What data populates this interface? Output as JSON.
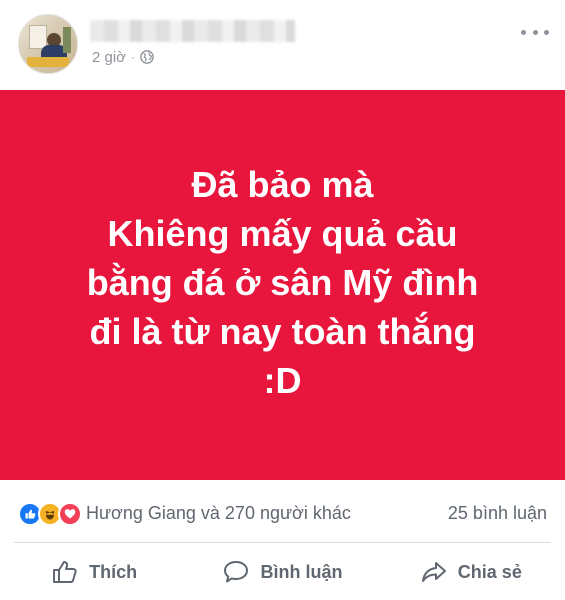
{
  "post": {
    "time": "2 giờ",
    "separator": "·",
    "privacy_icon": "globe-icon",
    "content_lines": [
      "Đã bảo mà",
      "Khiêng mấy quả cầu",
      "bằng đá ở sân Mỹ đình",
      "đi là từ nay toàn thắng",
      ":D"
    ],
    "background_color": "#e8163c",
    "text_color": "#ffffff"
  },
  "reactions": {
    "icons": [
      "like-icon",
      "haha-icon",
      "love-icon"
    ],
    "summary": "Hương Giang và 270 người khác",
    "comments": "25 bình luận"
  },
  "actions": {
    "like_label": "Thích",
    "comment_label": "Bình luận",
    "share_label": "Chia sẻ"
  },
  "colors": {
    "like_blue": "#1877f2",
    "haha_yellow": "#f7b125",
    "love_red": "#f33e58",
    "muted_text": "#606770"
  }
}
